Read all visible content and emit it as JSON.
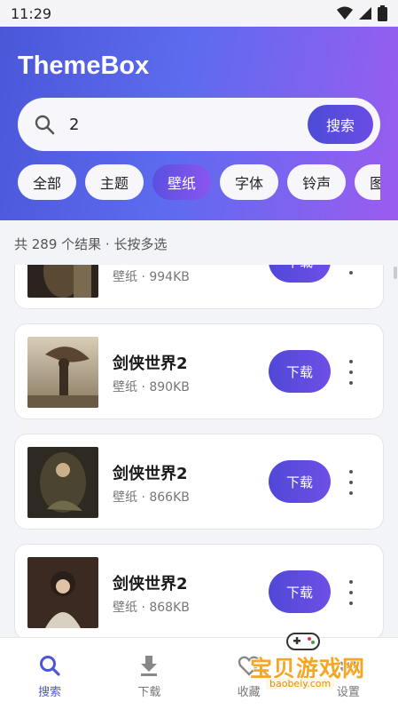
{
  "status": {
    "time": "11:29"
  },
  "header": {
    "title": "ThemeBox"
  },
  "search": {
    "value": "2",
    "button_label": "搜索"
  },
  "categories": [
    {
      "label": "全部"
    },
    {
      "label": "主题"
    },
    {
      "label": "壁纸",
      "active": true
    },
    {
      "label": "字体"
    },
    {
      "label": "铃声"
    },
    {
      "label": "图"
    }
  ],
  "results": {
    "summary": "共 289 个结果 · 长按多选",
    "items": [
      {
        "title": "",
        "meta": "壁纸 · 994KB",
        "button": "下载"
      },
      {
        "title": "剑侠世界2",
        "meta": "壁纸 · 890KB",
        "button": "下载"
      },
      {
        "title": "剑侠世界2",
        "meta": "壁纸 · 866KB",
        "button": "下载"
      },
      {
        "title": "剑侠世界2",
        "meta": "壁纸 · 868KB",
        "button": "下载"
      }
    ]
  },
  "nav": {
    "items": [
      {
        "label": "搜索",
        "icon": "search-icon",
        "active": true
      },
      {
        "label": "下载",
        "icon": "download-icon"
      },
      {
        "label": "收藏",
        "icon": "heart-icon"
      },
      {
        "label": "设置",
        "icon": "settings-icon"
      }
    ]
  },
  "watermark": {
    "main": "宝贝游戏网",
    "sub": "baobeiy.com"
  },
  "colors": {
    "accent": "#4b55d6",
    "gradient_start": "#4b57d8",
    "gradient_end": "#9b5cf0"
  }
}
